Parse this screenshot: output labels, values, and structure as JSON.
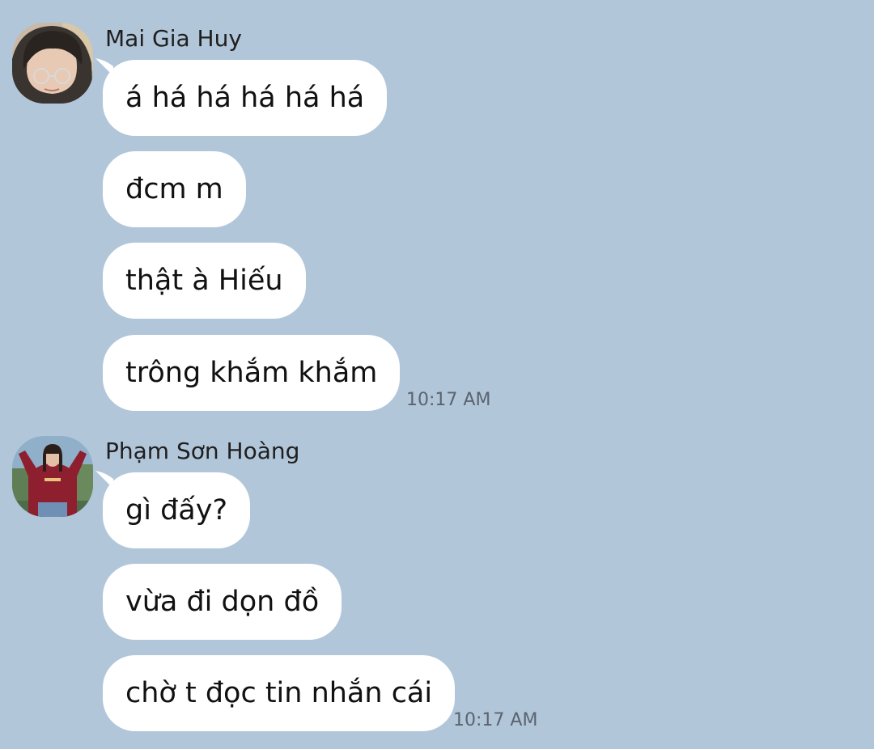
{
  "conversation": {
    "groups": [
      {
        "sender": "Mai Gia Huy",
        "avatar": "avatar-mai-gia-huy",
        "messages": [
          "á há há há há há",
          "đcm m",
          "thật à Hiếu",
          "trông khắm khắm"
        ],
        "time": "10:17 AM"
      },
      {
        "sender": "Phạm Sơn Hoàng",
        "avatar": "avatar-pham-son-hoang",
        "messages": [
          "gì đấy?",
          "vừa đi dọn đồ",
          "chờ t đọc tin nhắn cái"
        ],
        "time": "10:17 AM"
      }
    ]
  },
  "colors": {
    "background": "#b2c6da",
    "bubble": "#ffffff",
    "timestamp": "#5a6470"
  }
}
